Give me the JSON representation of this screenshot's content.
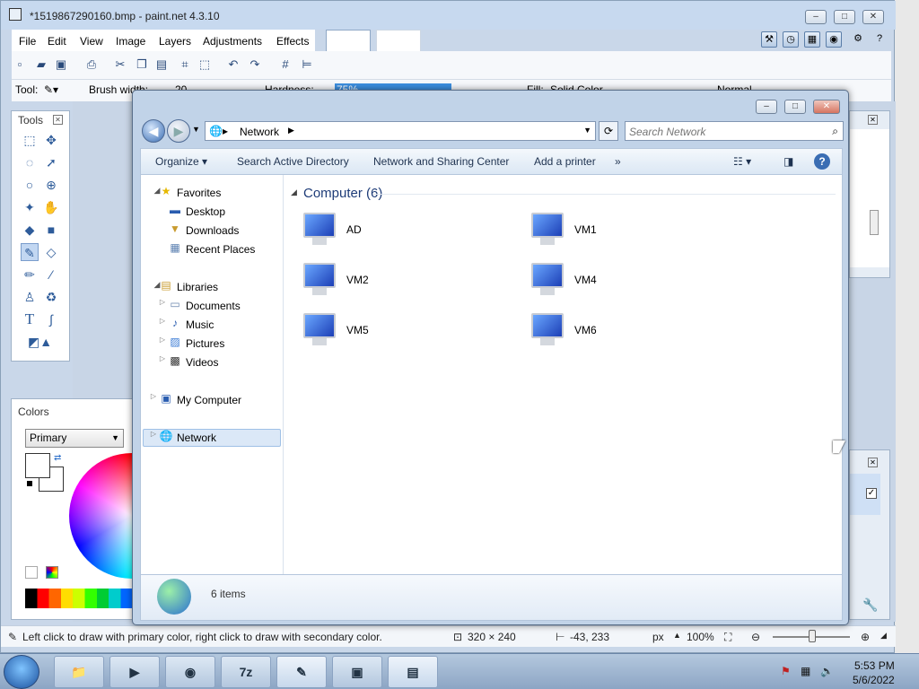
{
  "paintnet": {
    "title": "*1519867290160.bmp - paint.net 4.3.10",
    "menu": [
      "File",
      "Edit",
      "View",
      "Image",
      "Layers",
      "Adjustments",
      "Effects"
    ],
    "options": {
      "tool_label": "Tool:",
      "brush_width_label": "Brush width:",
      "brush_width_value": "20",
      "hardness_label": "Hardness:",
      "hardness_value": "75%",
      "fill_label": "Fill:",
      "fill_value": "Solid Color",
      "blend_mode": "Normal"
    },
    "tools_panel_title": "Tools",
    "colors_panel_title": "Colors",
    "colors_selector": "Primary",
    "status": {
      "hint": "Left click to draw with primary color, right click to draw with secondary color.",
      "image_size": "320 × 240",
      "cursor_pos": "-43, 233",
      "unit": "px",
      "zoom": "100%"
    },
    "hardness_percent": 75
  },
  "explorer": {
    "breadcrumb": "Network",
    "search_placeholder": "Search Network",
    "commands": [
      "Organize ▾",
      "Search Active Directory",
      "Network and Sharing Center",
      "Add a printer",
      "»"
    ],
    "nav": {
      "favorites": "Favorites",
      "favorites_items": [
        "Desktop",
        "Downloads",
        "Recent Places"
      ],
      "libraries": "Libraries",
      "libraries_items": [
        "Documents",
        "Music",
        "Pictures",
        "Videos"
      ],
      "computer": "My Computer",
      "network": "Network"
    },
    "group_header": "Computer (6)",
    "computers": [
      "AD",
      "VM1",
      "VM2",
      "VM4",
      "VM5",
      "VM6"
    ],
    "item_count": "6 items"
  },
  "taskbar": {
    "items": [
      "explorer",
      "media-player",
      "chrome",
      "7z",
      "paintnet",
      "office",
      "network-window"
    ],
    "time": "5:53 PM",
    "date": "5/6/2022"
  },
  "colors": {
    "accent": "#3a6db3",
    "selection": "#dbe8f7",
    "group_header": "#1e3c78"
  }
}
